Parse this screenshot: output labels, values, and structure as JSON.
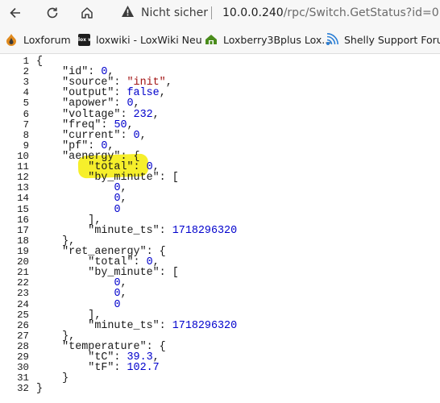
{
  "browser": {
    "security_label": "Nicht sicher",
    "url_host": "10.0.0.240",
    "url_path": "/rpc/Switch.GetStatus?id=0"
  },
  "bookmarks": [
    {
      "label": "Loxforum",
      "icon": "loxforum-icon"
    },
    {
      "label": "loxwiki - LoxWiki Neu",
      "icon": "loxwiki-icon",
      "icon_text": "lox wiki"
    },
    {
      "label": "Loxberry3Bplus Lox...",
      "icon": "loxberry-icon"
    },
    {
      "label": "Shelly Support Foru...",
      "icon": "shelly-icon"
    }
  ],
  "json_lines": [
    {
      "n": "1",
      "text": "{"
    },
    {
      "n": "2",
      "text": "    \"id\": 0,"
    },
    {
      "n": "3",
      "text": "    \"source\": \"init\","
    },
    {
      "n": "4",
      "text": "    \"output\": false,"
    },
    {
      "n": "5",
      "text": "    \"apower\": 0,"
    },
    {
      "n": "6",
      "text": "    \"voltage\": 232,"
    },
    {
      "n": "7",
      "text": "    \"freq\": 50,"
    },
    {
      "n": "8",
      "text": "    \"current\": 0,"
    },
    {
      "n": "9",
      "text": "    \"pf\": 0,"
    },
    {
      "n": "10",
      "text": "    \"aenergy\": {"
    },
    {
      "n": "11",
      "text": "        \"total\": 0,"
    },
    {
      "n": "12",
      "text": "        \"by_minute\": ["
    },
    {
      "n": "13",
      "text": "            0,"
    },
    {
      "n": "14",
      "text": "            0,"
    },
    {
      "n": "15",
      "text": "            0"
    },
    {
      "n": "16",
      "text": "        ],"
    },
    {
      "n": "17",
      "text": "        \"minute_ts\": 1718296320"
    },
    {
      "n": "18",
      "text": "    },"
    },
    {
      "n": "19",
      "text": "    \"ret_aenergy\": {"
    },
    {
      "n": "20",
      "text": "        \"total\": 0,"
    },
    {
      "n": "21",
      "text": "        \"by_minute\": ["
    },
    {
      "n": "22",
      "text": "            0,"
    },
    {
      "n": "23",
      "text": "            0,"
    },
    {
      "n": "24",
      "text": "            0"
    },
    {
      "n": "25",
      "text": "        ],"
    },
    {
      "n": "26",
      "text": "        \"minute_ts\": 1718296320"
    },
    {
      "n": "27",
      "text": "    },"
    },
    {
      "n": "28",
      "text": "    \"temperature\": {"
    },
    {
      "n": "29",
      "text": "        \"tC\": 39.3,"
    },
    {
      "n": "30",
      "text": "        \"tF\": 102.7"
    },
    {
      "n": "31",
      "text": "    }"
    },
    {
      "n": "32",
      "text": "}"
    }
  ],
  "highlighted_line": "11",
  "colors": {
    "string": "#a31515",
    "number": "#0000cc",
    "highlight": "#f5ee20"
  }
}
